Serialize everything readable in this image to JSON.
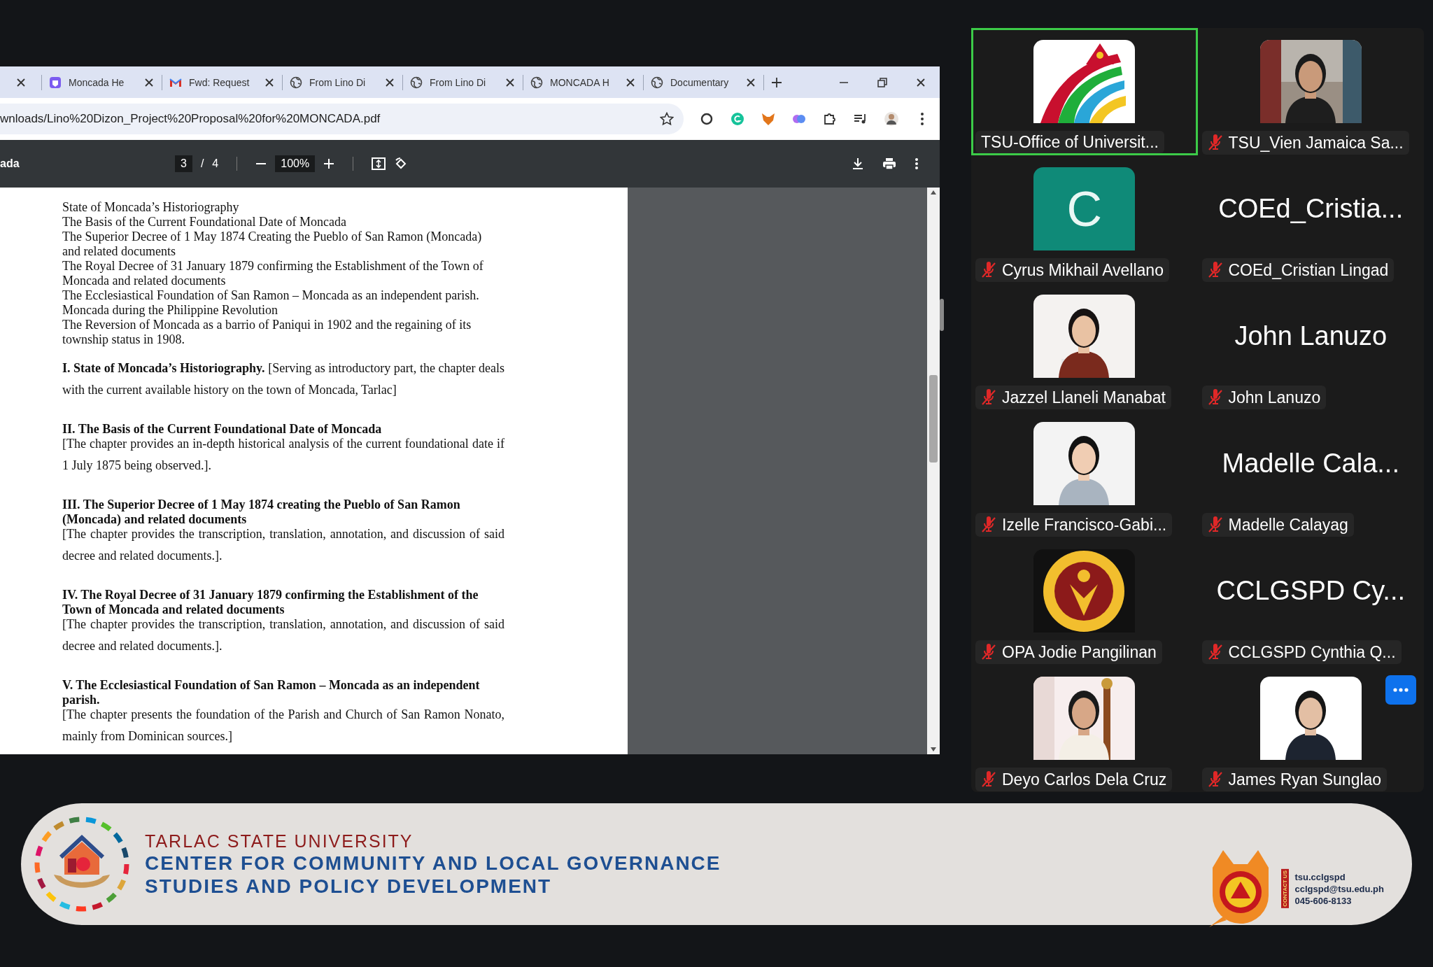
{
  "browser": {
    "tabs": [
      {
        "title": "Moncada He"
      },
      {
        "title": "Fwd: Request"
      },
      {
        "title": "From Lino Di"
      },
      {
        "title": "From Lino Di"
      },
      {
        "title": "MONCADA H"
      },
      {
        "title": "Documentary"
      }
    ],
    "address": "wnloads/Lino%20Dizon_Project%20Proposal%20for%20MONCADA.pdf"
  },
  "pdf_viewer": {
    "title": "ada",
    "page": "3",
    "separator": "/",
    "page_count": "4",
    "zoom": "100%"
  },
  "document": {
    "contents": [
      "State of Moncada’s Historiography",
      "The Basis of the Current Foundational Date of Moncada",
      "The Superior Decree of 1 May 1874 Creating the Pueblo of San Ramon (Moncada) and related documents",
      "The Royal Decree of 31 January 1879 confirming the Establishment of the Town of Moncada and related documents",
      "The Ecclesiastical Foundation of San Ramon – Moncada as an independent parish.",
      "Moncada during the Philippine Revolution",
      "The Reversion of Moncada as a barrio of Paniqui in 1902 and the regaining of its township status in 1908."
    ],
    "sections": [
      {
        "kind": "inline",
        "text": "**I. State of Moncada’s Historiography.** [Serving as introductory part, the chapter deals with the current available history on the town of Moncada, Tarlac]"
      },
      {
        "kind": "block",
        "heading": "II. The Basis of the Current Foundational Date of Moncada",
        "body": "[The chapter provides an in-depth historical analysis of the current foundational date if 1 July 1875 being observed.]."
      },
      {
        "kind": "block",
        "heading": "III. The Superior Decree of 1 May 1874 creating the Pueblo of San Ramon (Moncada) and related documents",
        "body": " [The chapter provides the transcription, translation, annotation, and discussion of said decree and related documents.]."
      },
      {
        "kind": "block",
        "heading": "IV. The Royal Decree of 31 January 1879 confirming the Establishment of the Town of Moncada and related documents",
        "body": "[The chapter provides the transcription, translation, annotation, and discussion of said decree and related documents.]."
      },
      {
        "kind": "block",
        "heading": "V. The Ecclesiastical Foundation of San Ramon – Moncada as an independent parish.",
        "body": "[The chapter presents the foundation of the Parish and Church of San Ramon Nonato, mainly from Dominican sources.]"
      }
    ]
  },
  "participants": [
    {
      "kind": "picture",
      "name": "TSU-Office of Universit...",
      "muted": false,
      "speaking": true
    },
    {
      "kind": "picture",
      "name": "TSU_Vien Jamaica Sa...",
      "muted": true,
      "speaking": false
    },
    {
      "kind": "initial",
      "initial": "C",
      "name": "Cyrus Mikhail Avellano",
      "muted": true,
      "speaking": false
    },
    {
      "kind": "name",
      "display_name": "COEd_Cristia...",
      "name": "COEd_Cristian Lingad",
      "muted": true,
      "speaking": false
    },
    {
      "kind": "picture",
      "name": "Jazzel Llaneli Manabat",
      "muted": true,
      "speaking": false
    },
    {
      "kind": "name",
      "display_name": "John Lanuzo",
      "name": "John Lanuzo",
      "muted": true,
      "speaking": false
    },
    {
      "kind": "picture",
      "name": "Izelle Francisco-Gabi...",
      "muted": true,
      "speaking": false
    },
    {
      "kind": "name",
      "display_name": "Madelle Cala...",
      "name": "Madelle Calayag",
      "muted": true,
      "speaking": false
    },
    {
      "kind": "picture",
      "name": "OPA Jodie Pangilinan",
      "muted": true,
      "speaking": false
    },
    {
      "kind": "name",
      "display_name": "CCLGSPD Cy...",
      "name": "CCLGSPD Cynthia Q...",
      "muted": true,
      "speaking": false
    },
    {
      "kind": "picture",
      "name": "Deyo Carlos Dela Cruz",
      "muted": true,
      "speaking": false
    },
    {
      "kind": "picture",
      "name": "James Ryan Sunglao",
      "muted": true,
      "speaking": false
    }
  ],
  "banner": {
    "university": "TARLAC STATE UNIVERSITY",
    "center_lines": [
      "CENTER FOR COMMUNITY AND LOCAL GOVERNANCE",
      "STUDIES AND POLICY DEVELOPMENT"
    ],
    "contact_tag": "CONTACT US",
    "contacts": [
      "tsu.cclgspd",
      "cclgspd@tsu.edu.ph",
      "045-606-8133"
    ]
  }
}
